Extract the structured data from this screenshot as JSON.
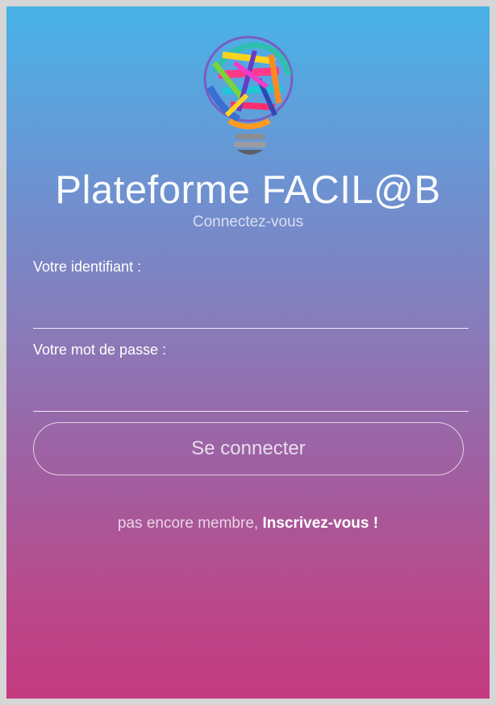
{
  "header": {
    "title": "Plateforme FACIL@B",
    "subtitle": "Connectez-vous"
  },
  "form": {
    "identifier_label": "Votre identifiant :",
    "identifier_value": "",
    "password_label": "Votre mot de passe :",
    "password_value": "",
    "login_button_label": "Se connecter"
  },
  "register": {
    "prefix": "pas encore membre, ",
    "link": "Inscrivez-vous !"
  },
  "colors": {
    "gradient_top": "#48b3e8",
    "gradient_bottom": "#c53a80",
    "text": "#ffffff"
  },
  "logo": {
    "icon": "colorful-lightbulb-logo"
  }
}
